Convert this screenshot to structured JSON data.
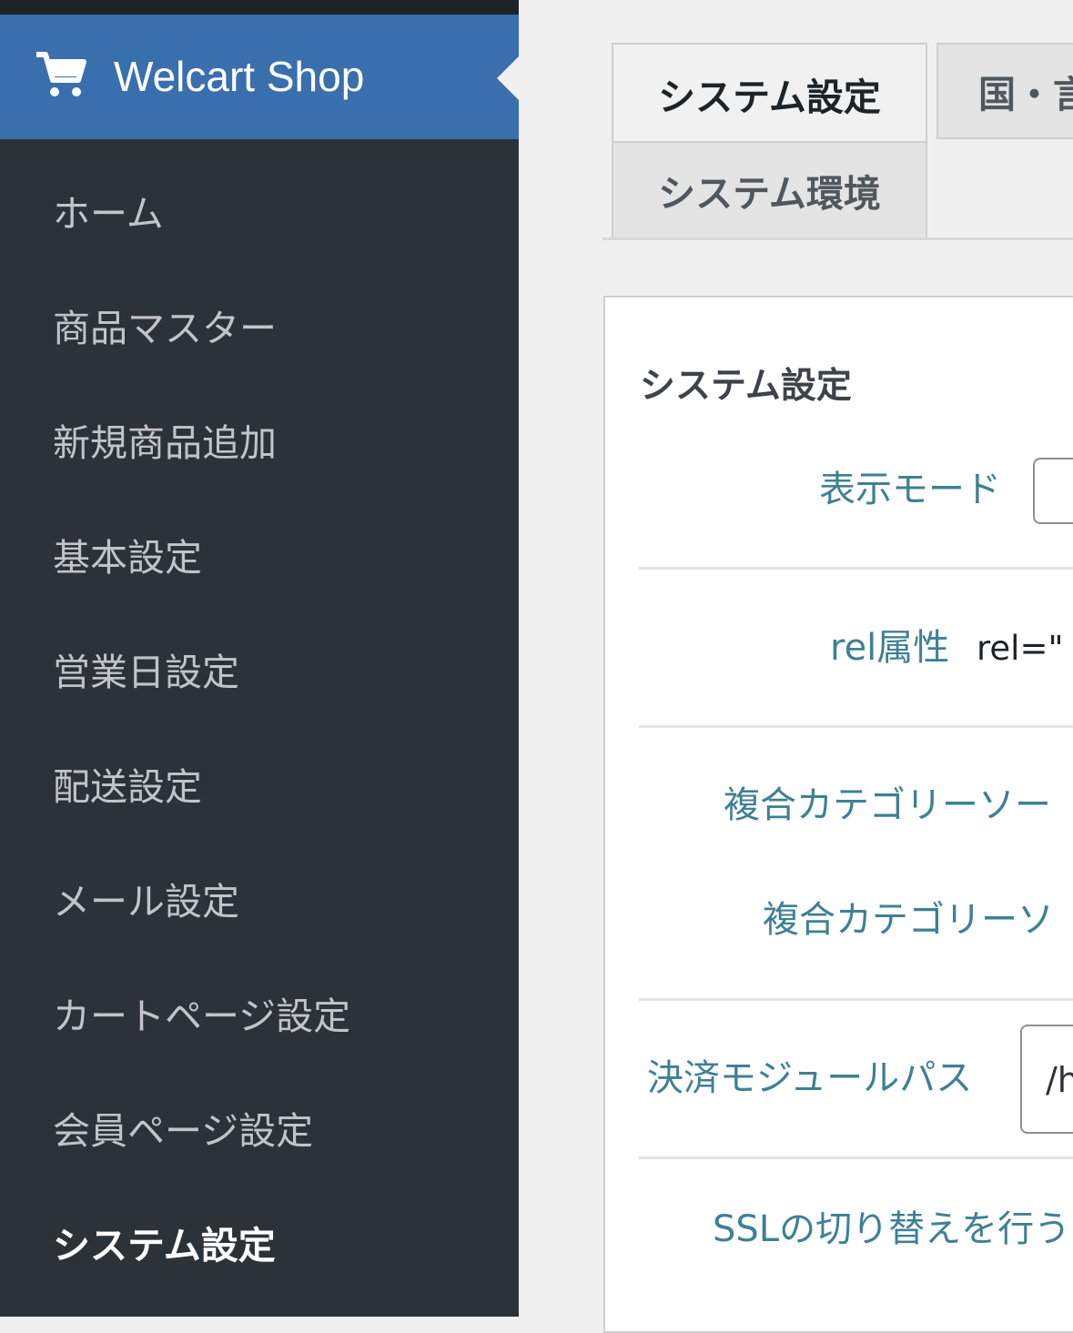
{
  "sidebar": {
    "header": {
      "title": "Welcart Shop",
      "icon": "cart-icon"
    },
    "items": [
      {
        "label": "ホーム"
      },
      {
        "label": "商品マスター"
      },
      {
        "label": "新規商品追加"
      },
      {
        "label": "基本設定"
      },
      {
        "label": "営業日設定"
      },
      {
        "label": "配送設定"
      },
      {
        "label": "メール設定"
      },
      {
        "label": "カートページ設定"
      },
      {
        "label": "会員ページ設定"
      },
      {
        "label": "システム設定",
        "active": true
      }
    ]
  },
  "tabs": [
    {
      "label": "システム設定",
      "active": true
    },
    {
      "label": "国・言"
    },
    {
      "label": "システム環境"
    }
  ],
  "panel": {
    "title": "システム設定",
    "fields": {
      "display_mode": {
        "label": "表示モード",
        "value": ""
      },
      "rel": {
        "label": "rel属性",
        "value": "rel=\""
      },
      "category_sort_1": {
        "label": "複合カテゴリーソー"
      },
      "category_sort_2": {
        "label": "複合カテゴリーソ"
      },
      "payment_module_path": {
        "label": "決済モジュールパス",
        "value": "/h"
      },
      "ssl": {
        "label": "SSLの切り替えを行う"
      }
    }
  },
  "colors": {
    "sidebar_bg": "#2c3338",
    "sidebar_active_bg": "#3a6fae",
    "label_color": "#3f8095"
  }
}
